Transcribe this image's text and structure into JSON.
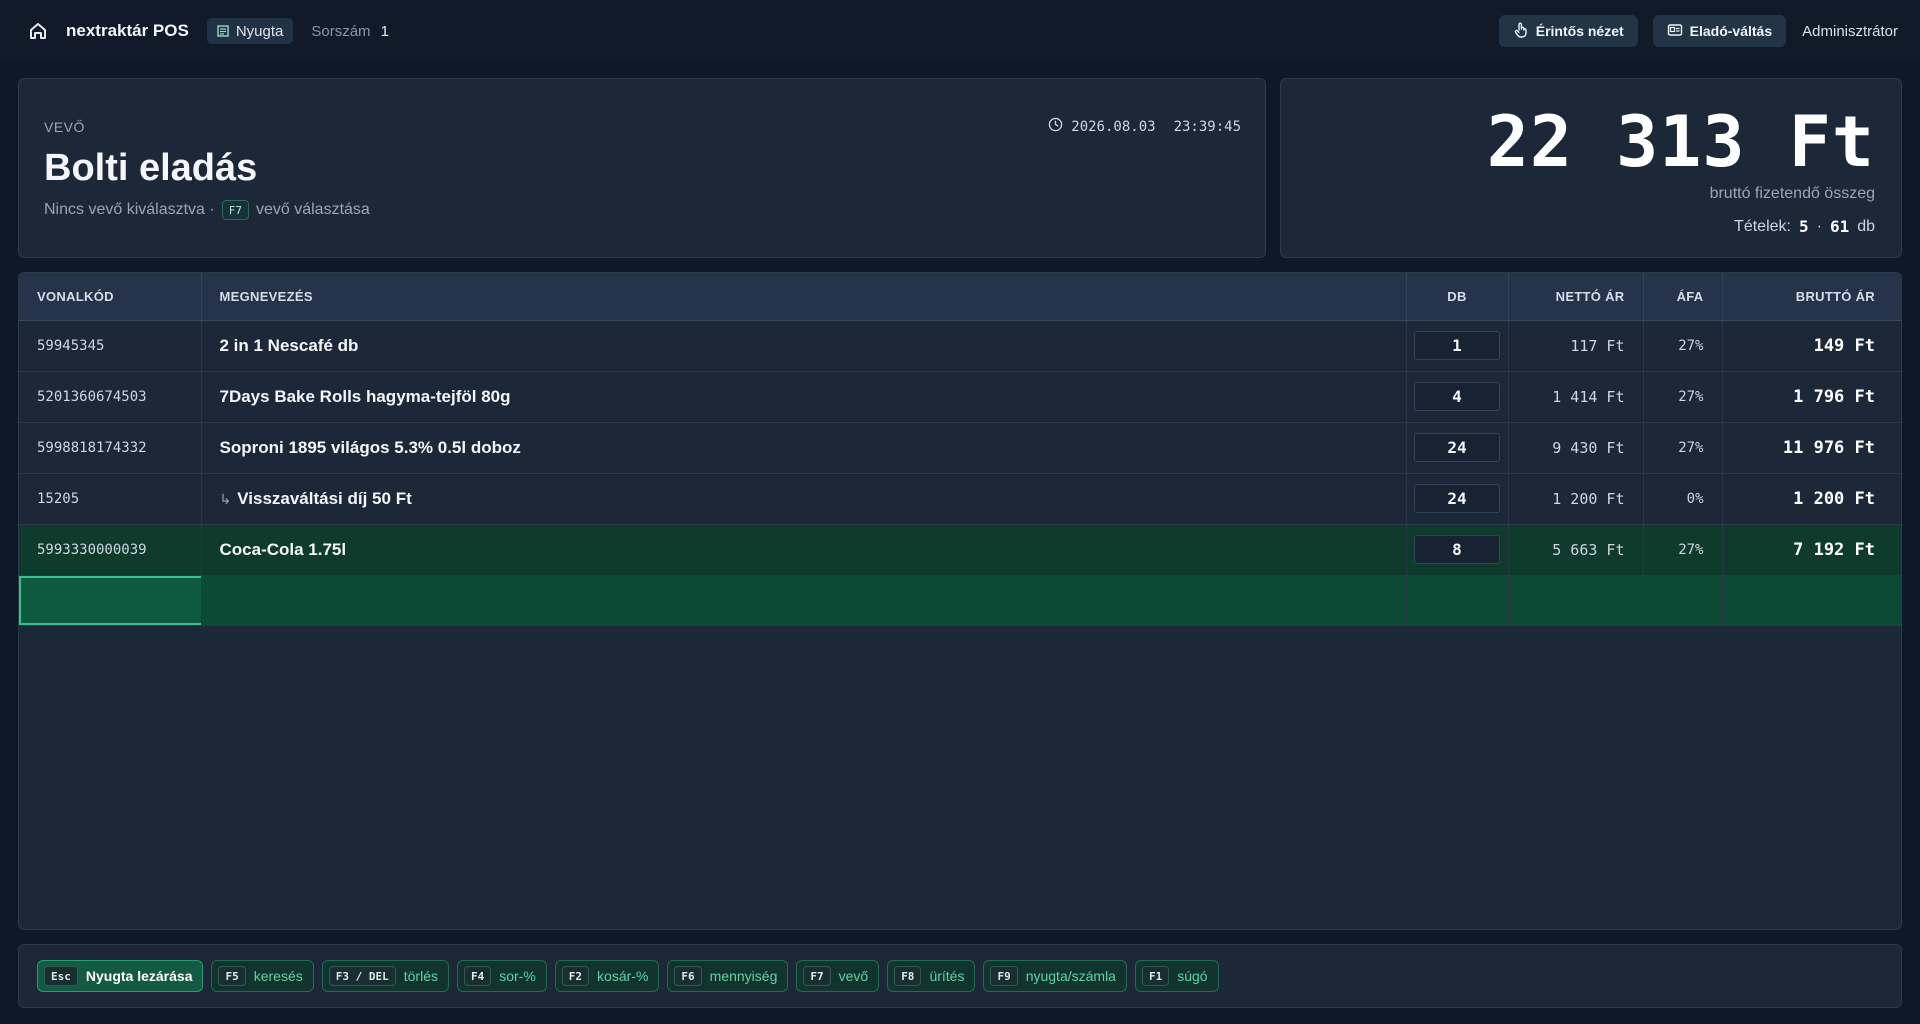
{
  "topbar": {
    "app_name": "nextraktár POS",
    "doc_type": "Nyugta",
    "serial_label": "Sorszám",
    "serial_value": "1",
    "touch_button": "Érintős nézet",
    "seller_button": "Eladó-váltás",
    "user": "Adminisztrátor"
  },
  "customer": {
    "label": "VEVŐ",
    "name": "Bolti eladás",
    "status": "Nincs vevő kiválasztva ·",
    "key": "F7",
    "action": "vevő választása",
    "date": "2026.08.03",
    "time": "23:39:45"
  },
  "total": {
    "amount": "22 313 Ft",
    "subtitle": "bruttó fizetendő összeg",
    "items_label": "Tételek:",
    "items_count": "5",
    "separator": "·",
    "qty_total": "61",
    "qty_unit": "db"
  },
  "table": {
    "headers": [
      "VONALKÓD",
      "MEGNEVEZÉS",
      "DB",
      "NETTÓ ÁR",
      "ÁFA",
      "BRUTTÓ ÁR"
    ],
    "rows": [
      {
        "barcode": "59945345",
        "name": "2 in 1 Nescafé db",
        "qty": "1",
        "net": "117 Ft",
        "vat": "27%",
        "gross": "149 Ft"
      },
      {
        "barcode": "5201360674503",
        "name": "7Days Bake Rolls hagyma-tejföl 80g",
        "qty": "4",
        "net": "1 414 Ft",
        "vat": "27%",
        "gross": "1 796 Ft"
      },
      {
        "barcode": "5998818174332",
        "name": "Soproni 1895 világos 5.3% 0.5l doboz",
        "qty": "24",
        "net": "9 430 Ft",
        "vat": "27%",
        "gross": "11 976 Ft"
      },
      {
        "barcode": "15205",
        "prefix": "↳",
        "name": "Visszaváltási díj 50 Ft",
        "qty": "24",
        "net": "1 200 Ft",
        "vat": "0%",
        "gross": "1 200 Ft"
      },
      {
        "barcode": "5993330000039",
        "name": "Coca-Cola 1.75l",
        "qty": "8",
        "net": "5 663 Ft",
        "vat": "27%",
        "gross": "7 192 Ft"
      }
    ],
    "entry_value": ""
  },
  "footer": {
    "keys": [
      {
        "key": "Esc",
        "label": "Nyugta lezárása"
      },
      {
        "key": "F5",
        "label": "keresés"
      },
      {
        "key": "F3 / DEL",
        "label": "törlés"
      },
      {
        "key": "F4",
        "label": "sor-%"
      },
      {
        "key": "F2",
        "label": "kosár-%"
      },
      {
        "key": "F6",
        "label": "mennyiség"
      },
      {
        "key": "F7",
        "label": "vevő"
      },
      {
        "key": "F8",
        "label": "ürítés"
      },
      {
        "key": "F9",
        "label": "nyugta/számla"
      },
      {
        "key": "F1",
        "label": "súgó"
      }
    ]
  },
  "colors": {
    "accent": "#3bbf8c",
    "background": "#0f1826",
    "panel": "#1c2738",
    "selected_row": "#0f3b2c"
  }
}
